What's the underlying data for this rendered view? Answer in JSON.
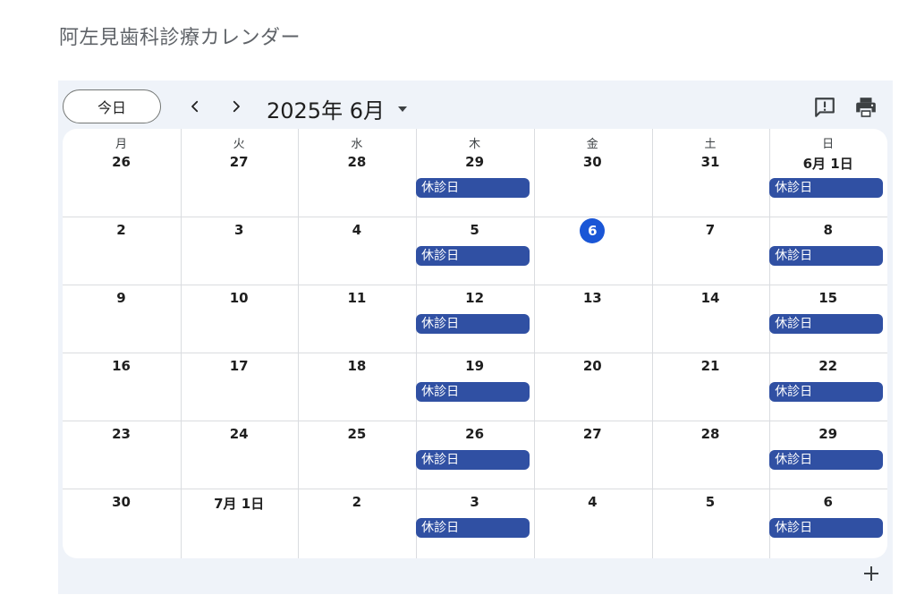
{
  "page": {
    "title": "阿左見歯科診療カレンダー"
  },
  "toolbar": {
    "today_label": "今日",
    "month_label": "2025年 6月",
    "prev_icon": "chevron-left-icon",
    "next_icon": "chevron-right-icon",
    "dropdown_icon": "caret-down-icon",
    "feedback_icon": "feedback-icon",
    "print_icon": "print-icon"
  },
  "calendar": {
    "weekdays": [
      "月",
      "火",
      "水",
      "木",
      "金",
      "土",
      "日"
    ],
    "weeks": [
      [
        "26",
        "27",
        "28",
        "29",
        "30",
        "31",
        "6月 1日"
      ],
      [
        "2",
        "3",
        "4",
        "5",
        "6",
        "7",
        "8"
      ],
      [
        "9",
        "10",
        "11",
        "12",
        "13",
        "14",
        "15"
      ],
      [
        "16",
        "17",
        "18",
        "19",
        "20",
        "21",
        "22"
      ],
      [
        "23",
        "24",
        "25",
        "26",
        "27",
        "28",
        "29"
      ],
      [
        "30",
        "7月 1日",
        "2",
        "3",
        "4",
        "5",
        "6"
      ]
    ],
    "today": "6",
    "event_label": "休診日",
    "closed_weekdays": [
      "木",
      "日"
    ],
    "accent_color": "#3050a3",
    "today_color": "#1a56d6"
  },
  "footer": {
    "add_icon": "plus-icon"
  }
}
